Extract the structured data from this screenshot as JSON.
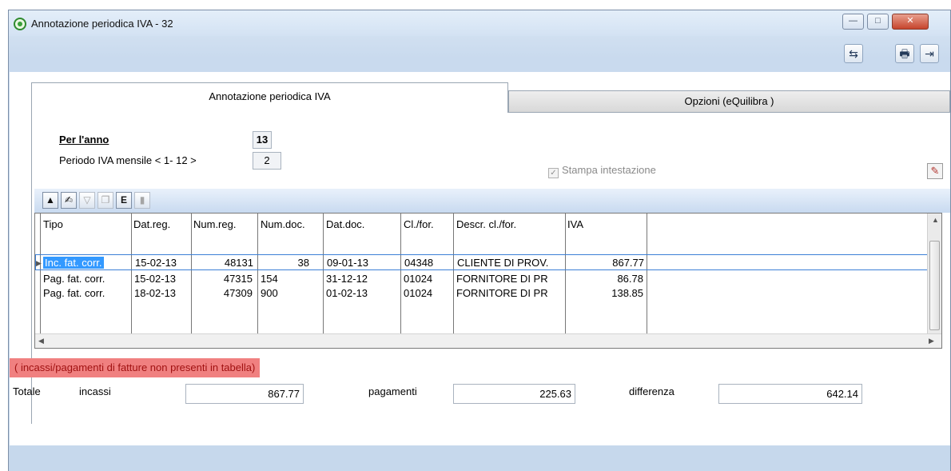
{
  "window": {
    "title": "Annotazione periodica IVA - 32",
    "buttons": {
      "minimize": "—",
      "maximize": "□",
      "close": "✕"
    }
  },
  "toolbar": {
    "icons": [
      "refresh-arrows-icon",
      "printer-icon",
      "exit-door-icon"
    ]
  },
  "tabs": [
    {
      "label": "Annotazione periodica IVA",
      "active": true
    },
    {
      "label": "Opzioni (eQuilibra )",
      "active": false
    }
  ],
  "form": {
    "per_anno_label": "Per l'anno",
    "per_anno_value": "13",
    "periodo_label": "Periodo IVA mensile < 1- 12 >",
    "periodo_value": "2",
    "stampa_label": "Stampa intestazione",
    "stampa_checked": true
  },
  "grid": {
    "columns": [
      "Tipo",
      "Dat.reg.",
      "Num.reg.",
      "Num.doc.",
      "Dat.doc.",
      "Cl./for.",
      "Descr. cl./for.",
      "IVA"
    ],
    "rows": [
      {
        "tipo": "Inc. fat. corr.",
        "datreg": "15-02-13",
        "numreg": "48131",
        "numdoc": "38",
        "datdoc": "09-01-13",
        "clfor": "04348",
        "descr": "CLIENTE DI PROV.",
        "iva": "867.77",
        "selected": true
      },
      {
        "tipo": "Pag. fat. corr.",
        "datreg": "15-02-13",
        "numreg": "47315",
        "numdoc": "154",
        "datdoc": "31-12-12",
        "clfor": "01024",
        "descr": "FORNITORE DI PR",
        "iva": "86.78",
        "selected": false
      },
      {
        "tipo": "Pag. fat. corr.",
        "datreg": "18-02-13",
        "numreg": "47309",
        "numdoc": "900",
        "datdoc": "01-02-13",
        "clfor": "01024",
        "descr": "FORNITORE DI PR",
        "iva": "138.85",
        "selected": false
      }
    ]
  },
  "note": "( incassi/pagamenti di fatture non presenti in tabella)",
  "totals": {
    "totale_label": "Totale",
    "incassi_label": "incassi",
    "incassi_value": "867.77",
    "pagamenti_label": "pagamenti",
    "pagamenti_value": "225.63",
    "differenza_label": "differenza",
    "differenza_value": "642.14"
  }
}
